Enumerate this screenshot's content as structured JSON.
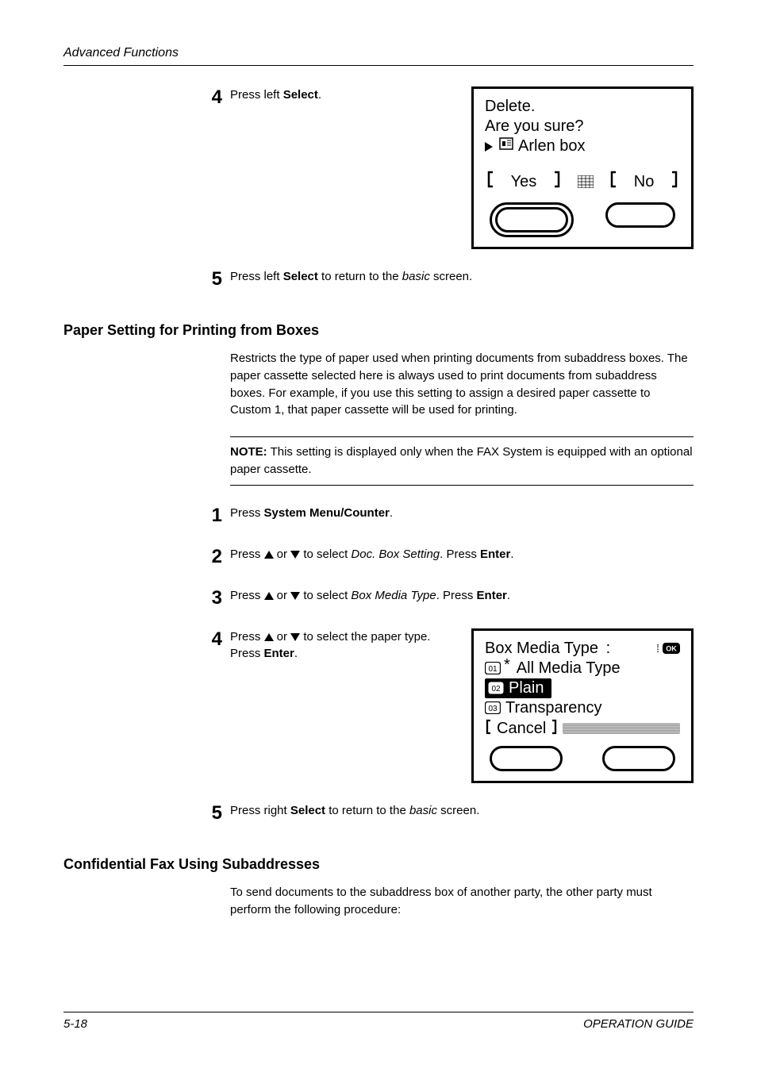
{
  "header": {
    "section_title": "Advanced Functions"
  },
  "step4a": {
    "num": "4",
    "text_parts": {
      "pre": "Press left ",
      "bold": "Select",
      "post": "."
    }
  },
  "lcd1": {
    "line1": "Delete.",
    "line2": "Are you sure?",
    "line3_label": "Arlen box",
    "yes": "Yes",
    "no": "No"
  },
  "step5a": {
    "num": "5",
    "pre": "Press left ",
    "bold": "Select",
    "mid": " to return to the ",
    "italic": "basic",
    "post": " screen."
  },
  "heading1": "Paper Setting for Printing from Boxes",
  "para1": "Restricts the type of paper used when printing documents from subaddress boxes. The paper cassette selected here is always used to print documents from subaddress boxes. For example, if you use this setting to assign a desired paper cassette to Custom 1, that paper cassette will be used for printing.",
  "note": {
    "label": "NOTE:",
    "text": " This setting is displayed only when the FAX System is equipped with an optional paper cassette."
  },
  "step1": {
    "num": "1",
    "pre": "Press ",
    "bold": "System Menu/Counter",
    "post": "."
  },
  "step2": {
    "num": "2",
    "pre": "Press ",
    "mid1": " or ",
    "mid2": " to select ",
    "italic": "Doc. Box Setting",
    "mid3": ". Press ",
    "bold": "Enter",
    "post": "."
  },
  "step3": {
    "num": "3",
    "pre": "Press ",
    "mid1": " or ",
    "mid2": " to select ",
    "italic": "Box Media Type",
    "mid3": ". Press ",
    "bold": "Enter",
    "post": "."
  },
  "step4b": {
    "num": "4",
    "pre": "Press ",
    "mid1": " or ",
    "mid2": " to select the paper type. Press ",
    "bold": "Enter",
    "post": "."
  },
  "lcd2": {
    "title": "Box Media Type",
    "colon": ":",
    "item1": "All Media Type",
    "item2": "Plain",
    "item3": "Transparency",
    "cancel": "Cancel",
    "ok": "OK"
  },
  "step5b": {
    "num": "5",
    "pre": "Press right ",
    "bold": "Select",
    "mid": " to return to the ",
    "italic": "basic",
    "post": " screen."
  },
  "heading2": "Confidential Fax Using Subaddresses",
  "para2": "To send documents to the subaddress box of another party, the other party must perform the following procedure:",
  "footer": {
    "left": "5-18",
    "right": "OPERATION GUIDE"
  }
}
